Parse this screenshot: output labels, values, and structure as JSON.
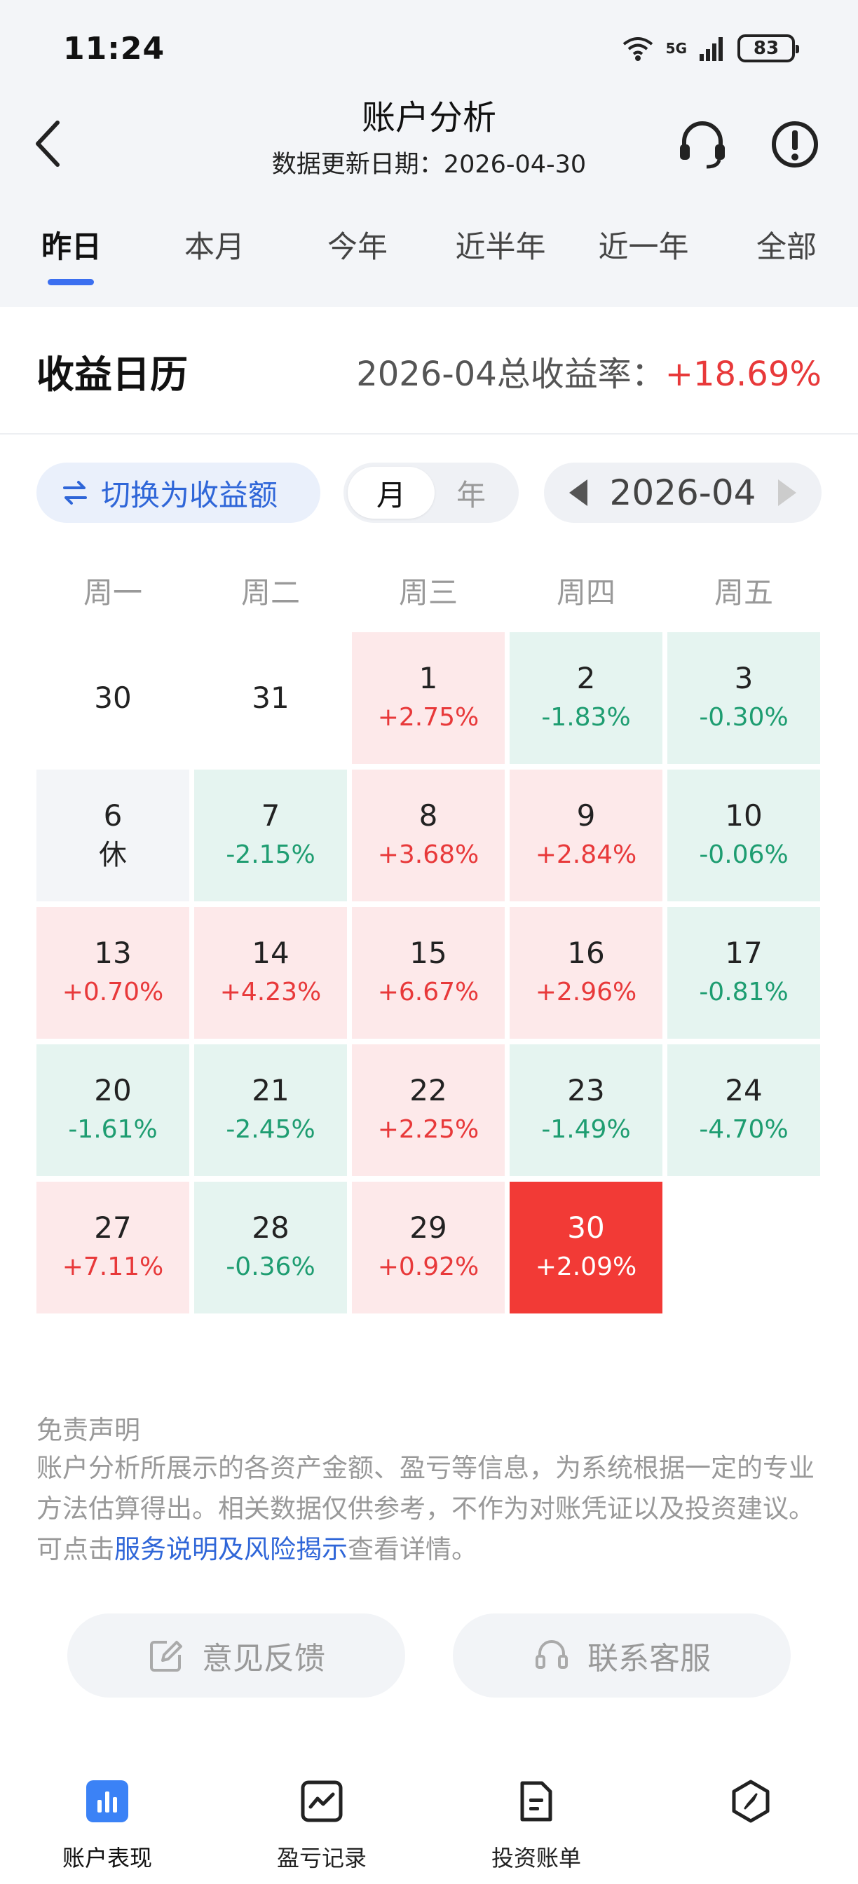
{
  "status_bar": {
    "time": "11:24",
    "network": "5G",
    "battery": "83"
  },
  "header": {
    "title": "账户分析",
    "subtitle": "数据更新日期：2026-04-30"
  },
  "tabs": [
    {
      "label": "昨日"
    },
    {
      "label": "本月"
    },
    {
      "label": "今年"
    },
    {
      "label": "近半年"
    },
    {
      "label": "近一年"
    },
    {
      "label": "全部"
    }
  ],
  "calendar_section": {
    "title": "收益日历",
    "rate_label": "2026-04总收益率：",
    "rate_value": "+18.69%",
    "switch_label": "切换为收益额",
    "view_month": "月",
    "view_year": "年",
    "period": "2026-04"
  },
  "weekdays": [
    "周一",
    "周二",
    "周三",
    "周四",
    "周五"
  ],
  "calendar": {
    "weeks": [
      [
        {
          "day": "30",
          "value": "",
          "kind": "empty"
        },
        {
          "day": "31",
          "value": "",
          "kind": "empty"
        },
        {
          "day": "1",
          "value": "+2.75%",
          "kind": "pos"
        },
        {
          "day": "2",
          "value": "-1.83%",
          "kind": "neg"
        },
        {
          "day": "3",
          "value": "-0.30%",
          "kind": "neg"
        }
      ],
      [
        {
          "day": "6",
          "value": "休",
          "kind": "rest"
        },
        {
          "day": "7",
          "value": "-2.15%",
          "kind": "neg"
        },
        {
          "day": "8",
          "value": "+3.68%",
          "kind": "pos"
        },
        {
          "day": "9",
          "value": "+2.84%",
          "kind": "pos"
        },
        {
          "day": "10",
          "value": "-0.06%",
          "kind": "neg"
        }
      ],
      [
        {
          "day": "13",
          "value": "+0.70%",
          "kind": "pos"
        },
        {
          "day": "14",
          "value": "+4.23%",
          "kind": "pos"
        },
        {
          "day": "15",
          "value": "+6.67%",
          "kind": "pos"
        },
        {
          "day": "16",
          "value": "+2.96%",
          "kind": "pos"
        },
        {
          "day": "17",
          "value": "-0.81%",
          "kind": "neg"
        }
      ],
      [
        {
          "day": "20",
          "value": "-1.61%",
          "kind": "neg"
        },
        {
          "day": "21",
          "value": "-2.45%",
          "kind": "neg"
        },
        {
          "day": "22",
          "value": "+2.25%",
          "kind": "pos"
        },
        {
          "day": "23",
          "value": "-1.49%",
          "kind": "neg"
        },
        {
          "day": "24",
          "value": "-4.70%",
          "kind": "neg"
        }
      ],
      [
        {
          "day": "27",
          "value": "+7.11%",
          "kind": "pos"
        },
        {
          "day": "28",
          "value": "-0.36%",
          "kind": "neg"
        },
        {
          "day": "29",
          "value": "+0.92%",
          "kind": "pos"
        },
        {
          "day": "30",
          "value": "+2.09%",
          "kind": "sel"
        }
      ]
    ]
  },
  "disclaimer": {
    "title": "免责声明",
    "text_before": "账户分析所展示的各资产金额、盈亏等信息，为系统根据一定的专业方法估算得出。相关数据仅供参考，不作为对账凭证以及投资建议。可点击",
    "link": "服务说明及风险揭示",
    "text_after": "查看详情。"
  },
  "actions": {
    "feedback": "意见反馈",
    "service": "联系客服"
  },
  "bottom_nav": [
    {
      "label": "账户表现",
      "icon": "bar-chart-icon"
    },
    {
      "label": "盈亏记录",
      "icon": "line-chart-icon"
    },
    {
      "label": "投资账单",
      "icon": "document-icon"
    },
    {
      "label": "",
      "icon": "compass-icon"
    }
  ],
  "colors": {
    "accent": "#3b6ff0",
    "positive": "#e8393a",
    "negative": "#1e9d71",
    "positive_bg": "#fde9ea",
    "negative_bg": "#e5f4f0",
    "selected_bg": "#f23a36"
  }
}
